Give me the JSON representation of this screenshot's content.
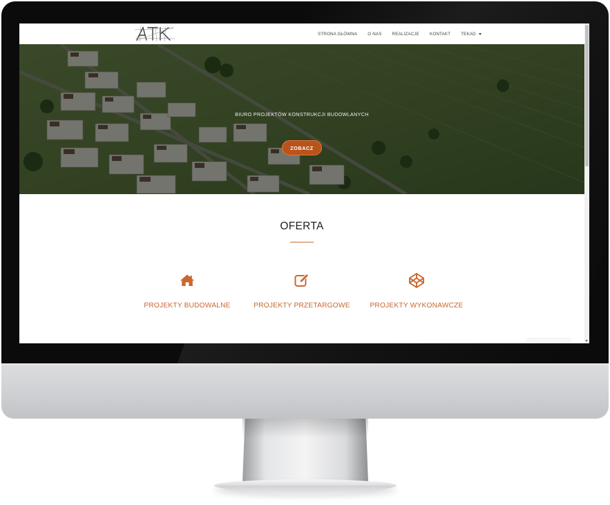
{
  "site": {
    "logo_alt": "ATK",
    "nav": {
      "items": [
        {
          "label": "STRONA GŁÓWNA"
        },
        {
          "label": "O NAS"
        },
        {
          "label": "REALIZACJE"
        },
        {
          "label": "KONTAKT"
        },
        {
          "label": "TEKAD",
          "dropdown": true
        }
      ]
    },
    "hero": {
      "subtitle": "BIURO PROJEKTÓW KONSTRUKCJI BUDOWLANYCH",
      "button_label": "ZOBACZ"
    },
    "offer": {
      "title": "OFERTA",
      "items": [
        {
          "label": "PROJEKTY BUDOWALNE",
          "icon": "home-icon"
        },
        {
          "label": "PROJEKTY PRZETARGOWE",
          "icon": "edit-icon"
        },
        {
          "label": "PROJEKTY WYKONAWCZE",
          "icon": "codepen-icon"
        }
      ]
    }
  },
  "colors": {
    "accent": "#c8672e",
    "button": "#b8541b",
    "bezel": "#0b0b0b",
    "chin": "#d0d1d4"
  }
}
